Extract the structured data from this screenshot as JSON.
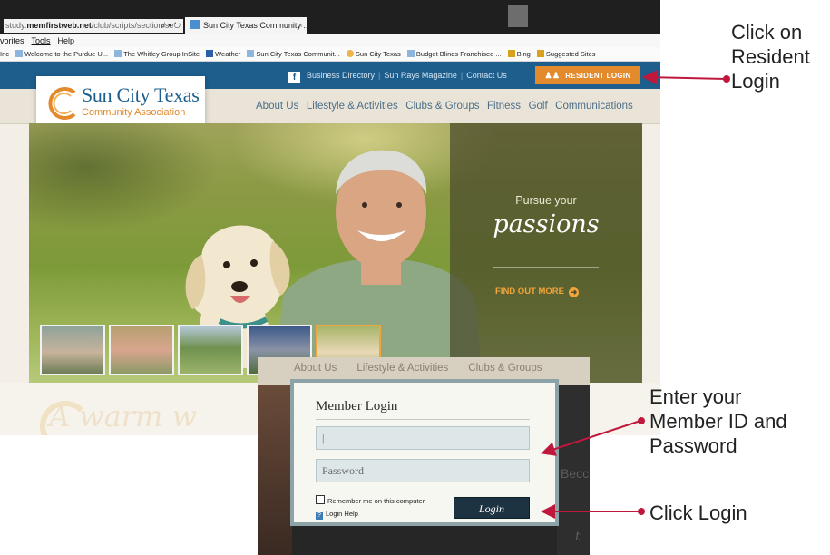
{
  "browser": {
    "address_prefix": "study.",
    "address_domain": "memfirstweb.net",
    "address_path": "/club/scripts/section/se",
    "address_controls": "⌕ ▾ ↻",
    "tab_title": "Sun City Texas Community ...",
    "tab_close": "×",
    "menu": [
      "vorites",
      "Tools",
      "Help"
    ],
    "favorites": [
      "Inc",
      "Welcome to the Purdue U...",
      "The Whitley Group InSite",
      "Weather",
      "Sun City Texas Communit...",
      "Sun City Texas",
      "Budget Blinds Franchisee ...",
      "Bing",
      "Suggested Sites"
    ]
  },
  "site": {
    "facebook": "f",
    "utility_links": [
      "Business Directory",
      "Sun Rays Magazine",
      "Contact Us"
    ],
    "utility_separator": "|",
    "resident_login": "RESIDENT LOGIN",
    "logo_name": "Sun City Texas",
    "logo_sub": "Community Association",
    "nav": [
      "About Us",
      "Lifestyle & Activities",
      "Clubs & Groups",
      "Fitness",
      "Golf",
      "Communications"
    ],
    "hero_line1": "Pursue your",
    "hero_line2": "passions",
    "hero_cta": "FIND OUT MORE",
    "below_text": "A warm w",
    "thumb_count": 5
  },
  "login": {
    "bg_nav": [
      "About Us",
      "Lifestyle & Activities",
      "Clubs & Groups"
    ],
    "bg_right_text": "Becc",
    "bg_right_italic": "t",
    "title": "Member Login",
    "username_value": "|",
    "password_placeholder": "Password",
    "remember": "Remember me on this computer",
    "help": "Login Help",
    "button": "Login"
  },
  "callouts": {
    "resident_login": [
      "Click on",
      "Resident",
      "Login"
    ],
    "credentials": [
      "Enter your",
      "Member ID and",
      "Password"
    ],
    "login_button": [
      "Click Login"
    ]
  },
  "colors": {
    "accent_orange": "#e38a2c",
    "site_blue": "#1d5e8d",
    "callout_arrow": "#c0183c"
  },
  "icons": [
    "facebook-icon",
    "residents-icon",
    "arrow-right-circle-icon",
    "help-icon",
    "checkbox-icon",
    "tab-favicon-icon"
  ]
}
